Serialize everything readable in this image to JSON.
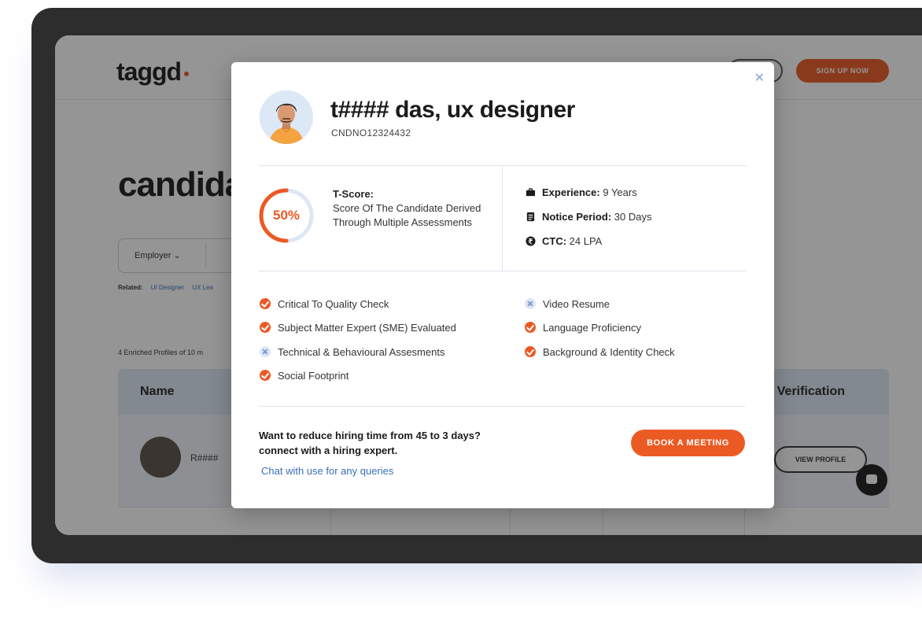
{
  "background": {
    "logo": "taggd",
    "signup_label": "SIGN UP NOW",
    "page_title": "candida",
    "filter_employer": "Employer ⌄",
    "related_label": "Related:",
    "related_links": [
      "UI Designer",
      "UX Lea"
    ],
    "profiles_count": "4 Enriched Profiles of 10 m",
    "table": {
      "col_name": "Name",
      "col_verification": "Verification",
      "row_name": "R####",
      "row_view_label": "VIEW PROFILE"
    }
  },
  "modal": {
    "close_icon": "close-icon",
    "candidate_name": "t#### das, ux designer",
    "candidate_id": "CNDNO12324432",
    "tscore": {
      "percent_label": "50%",
      "percent_value": 50,
      "title": "T-Score:",
      "description": "Score Of The Candidate Derived Through Multiple Assessments"
    },
    "meta": {
      "experience_label": "Experience:",
      "experience_value": "9 Years",
      "notice_label": "Notice Period:",
      "notice_value": "30 Days",
      "ctc_label": "CTC:",
      "ctc_value": "24 LPA"
    },
    "checks_left": [
      {
        "label": "Critical To Quality Check",
        "status": "done"
      },
      {
        "label": "Subject Matter Expert (SME) Evaluated",
        "status": "done"
      },
      {
        "label": "Technical & Behavioural Assesments",
        "status": "pending"
      },
      {
        "label": "Social Footprint",
        "status": "done"
      }
    ],
    "checks_right": [
      {
        "label": "Video Resume",
        "status": "pending"
      },
      {
        "label": "Language Proficiency",
        "status": "done"
      },
      {
        "label": "Background & Identity Check",
        "status": "done"
      }
    ],
    "cta_line1": "Want to reduce hiring time from 45 to 3 days?",
    "cta_line2": "connect with a hiring expert.",
    "cta_link": "Chat with use for any queries",
    "book_button": "BOOK A MEETING"
  },
  "colors": {
    "accent": "#ec5a24",
    "link": "#3a6fb6",
    "pending": "#dfe7f4"
  }
}
